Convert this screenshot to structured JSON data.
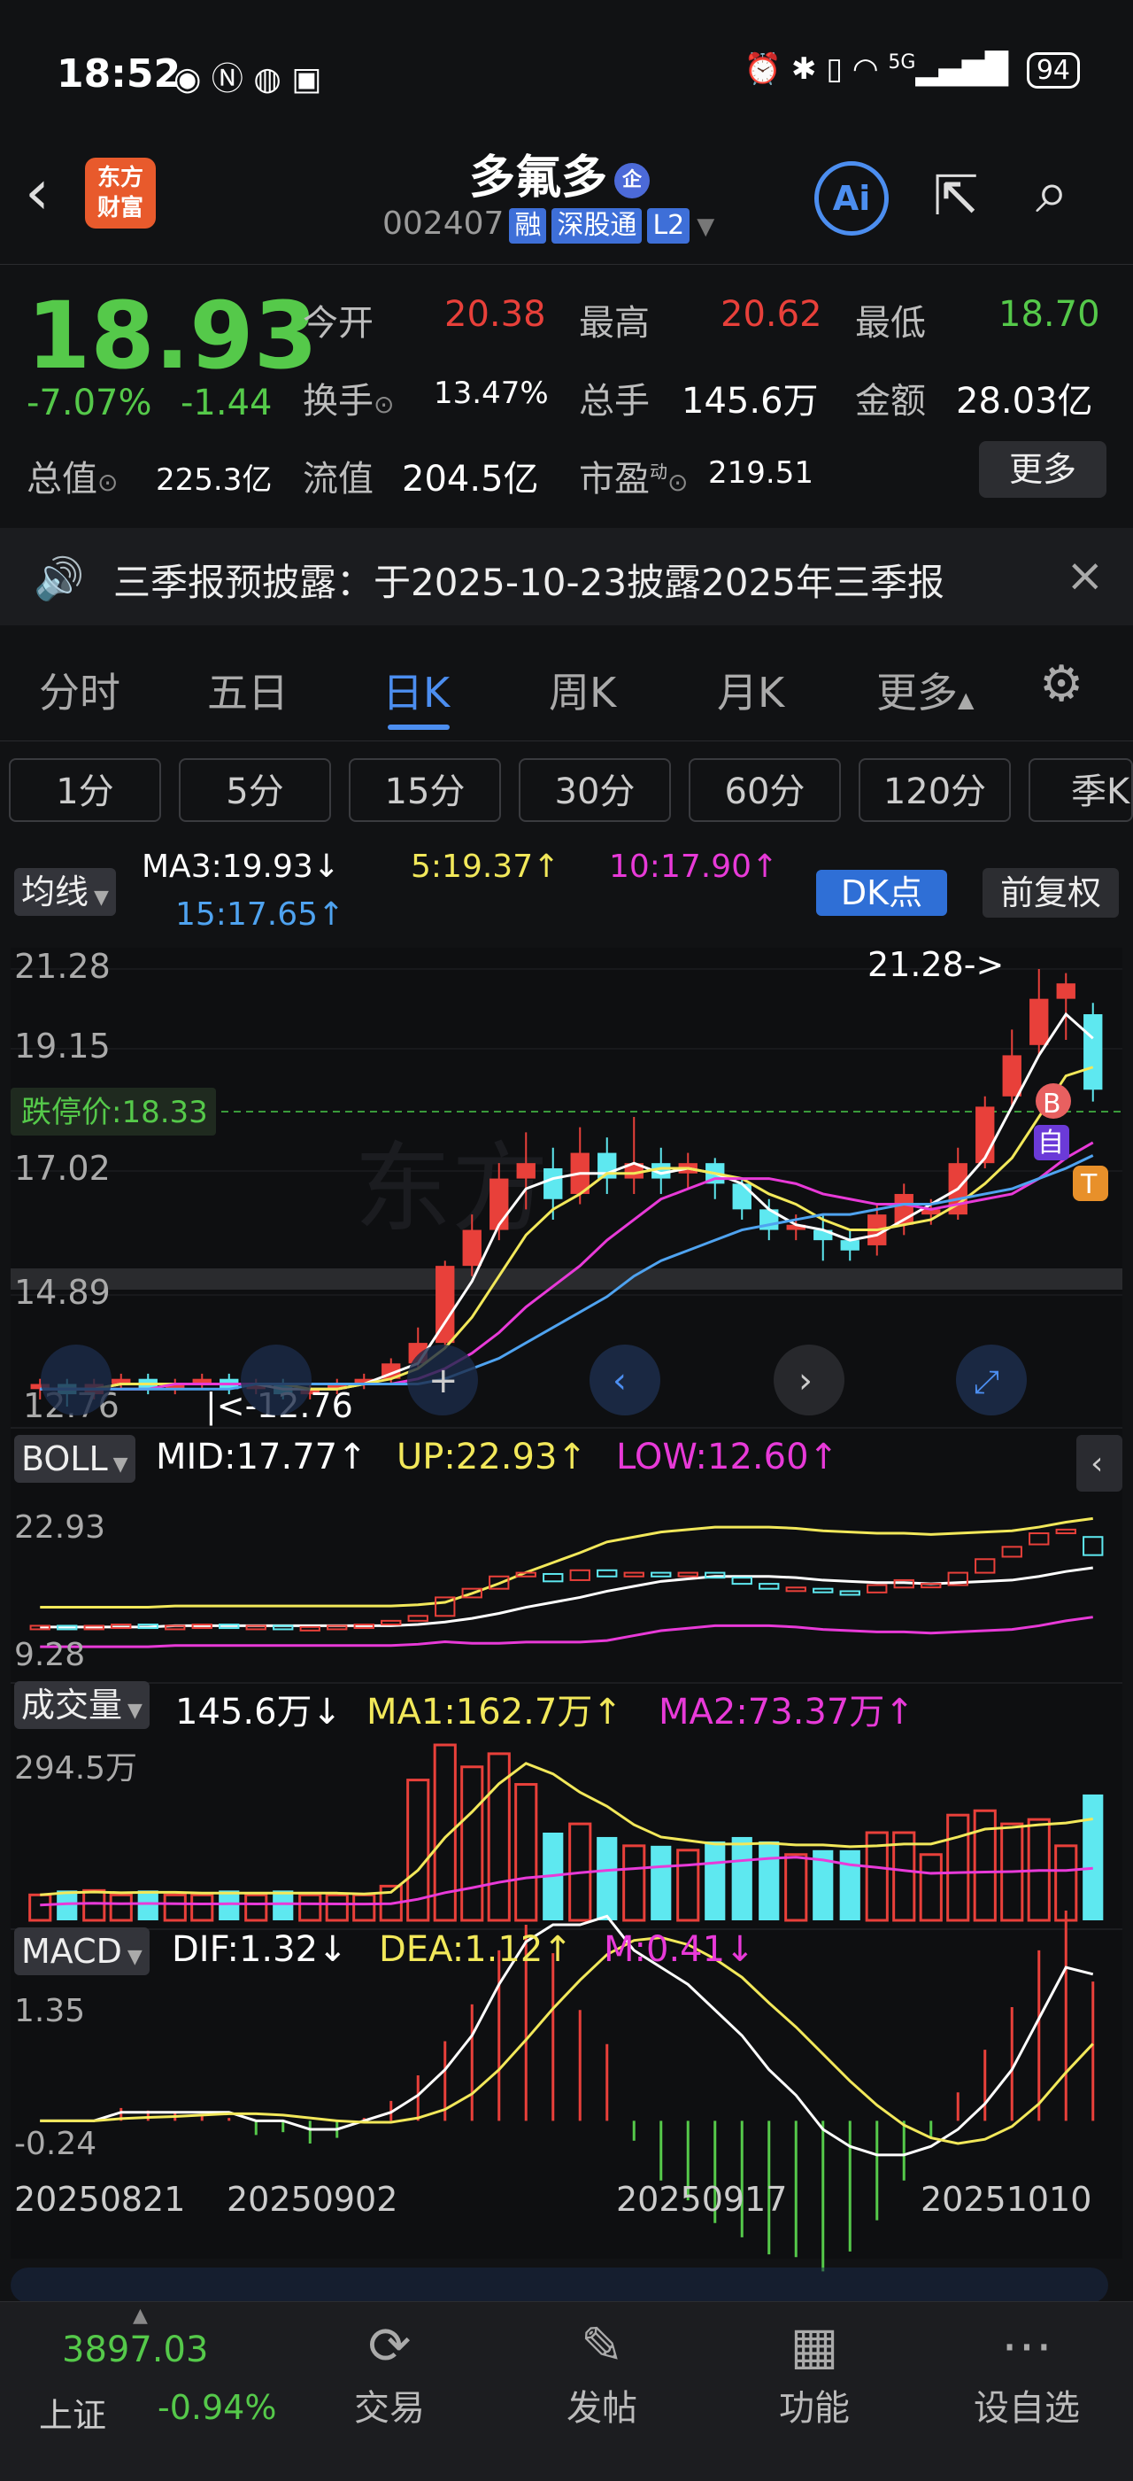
{
  "status_bar": {
    "time": "18:52",
    "network": "5G",
    "battery": "94"
  },
  "header": {
    "logo_line1": "东方",
    "logo_line2": "财富",
    "stock_name": "多氟多",
    "badge": "企",
    "code": "002407",
    "tags": [
      "融",
      "深股通",
      "L2"
    ],
    "ai_label": "Ai"
  },
  "quote": {
    "price": "18.93",
    "change_pct": "-7.07%",
    "change": "-1.44",
    "open_label": "今开",
    "open": "20.38",
    "high_label": "最高",
    "high": "20.62",
    "low_label": "最低",
    "low": "18.70",
    "turnover_label": "换手",
    "turnover": "13.47%",
    "volume_label": "总手",
    "volume": "145.6万",
    "amount_label": "金额",
    "amount": "28.03亿",
    "mcap_label": "总值",
    "mcap": "225.3亿",
    "float_label": "流值",
    "float": "204.5亿",
    "pe_label": "市盈",
    "pe_sup": "动",
    "pe": "219.51",
    "more": "更多"
  },
  "notice": {
    "text": "三季报预披露：于2025-10-23披露2025年三季报"
  },
  "tabs": [
    "分时",
    "五日",
    "日K",
    "周K",
    "月K",
    "更多"
  ],
  "active_tab": "日K",
  "periods": [
    "1分",
    "5分",
    "15分",
    "30分",
    "60分",
    "120分",
    "季K"
  ],
  "ma": {
    "selector": "均线",
    "ma3": "MA3:19.93",
    "ma5": "5:19.37",
    "ma10": "10:17.90",
    "ma15": "15:17.65",
    "dk": "DK点",
    "adjust": "前复权"
  },
  "kline": {
    "axis_labels": [
      "21.28",
      "19.15",
      "17.02",
      "14.89",
      "12.76"
    ],
    "limit_down_label": "跌停价:18.33",
    "max_label": "21.28->",
    "min_label": "12.76",
    "markers": [
      "B",
      "自",
      "T"
    ]
  },
  "boll": {
    "selector": "BOLL",
    "mid": "MID:17.77",
    "up": "UP:22.93",
    "low": "LOW:12.60",
    "axis_top": "22.93",
    "axis_bottom": "9.28"
  },
  "volume": {
    "selector": "成交量",
    "value": "145.6万",
    "ma1": "MA1:162.7万",
    "ma2": "MA2:73.37万",
    "axis_top": "294.5万"
  },
  "macd": {
    "selector": "MACD",
    "dif": "DIF:1.32",
    "dea": "DEA:1.12",
    "m": "M:0.41",
    "axis_top": "1.35",
    "axis_bottom": "-0.24"
  },
  "dates": [
    "20250821",
    "20250902",
    "20250917",
    "20251010"
  ],
  "bottom_bar": {
    "index_value": "3897.03",
    "index_name": "上证",
    "index_change": "-0.94%",
    "items": [
      "交易",
      "发帖",
      "功能",
      "设自选"
    ]
  },
  "chart_data": {
    "type": "candlestick",
    "candles": [
      {
        "o": 13.1,
        "c": 13.2,
        "h": 13.3,
        "l": 12.9
      },
      {
        "o": 13.2,
        "c": 13.0,
        "h": 13.3,
        "l": 12.76
      },
      {
        "o": 13.0,
        "c": 13.2,
        "h": 13.3,
        "l": 12.9
      },
      {
        "o": 13.2,
        "c": 13.3,
        "h": 13.4,
        "l": 13.1
      },
      {
        "o": 13.3,
        "c": 13.1,
        "h": 13.4,
        "l": 13.0
      },
      {
        "o": 13.1,
        "c": 13.2,
        "h": 13.3,
        "l": 13.0
      },
      {
        "o": 13.2,
        "c": 13.3,
        "h": 13.4,
        "l": 13.1
      },
      {
        "o": 13.3,
        "c": 13.1,
        "h": 13.4,
        "l": 13.0
      },
      {
        "o": 13.1,
        "c": 13.2,
        "h": 13.3,
        "l": 13.0
      },
      {
        "o": 13.2,
        "c": 13.0,
        "h": 13.3,
        "l": 12.9
      },
      {
        "o": 13.0,
        "c": 13.1,
        "h": 13.2,
        "l": 12.9
      },
      {
        "o": 13.1,
        "c": 13.2,
        "h": 13.3,
        "l": 13.0
      },
      {
        "o": 13.2,
        "c": 13.3,
        "h": 13.4,
        "l": 13.1
      },
      {
        "o": 13.3,
        "c": 13.6,
        "h": 13.7,
        "l": 13.2
      },
      {
        "o": 13.6,
        "c": 14.0,
        "h": 14.3,
        "l": 13.5
      },
      {
        "o": 14.0,
        "c": 15.5,
        "h": 15.6,
        "l": 13.9
      },
      {
        "o": 15.5,
        "c": 16.2,
        "h": 16.5,
        "l": 15.3
      },
      {
        "o": 16.2,
        "c": 17.2,
        "h": 17.5,
        "l": 16.0
      },
      {
        "o": 17.2,
        "c": 17.5,
        "h": 18.1,
        "l": 16.6
      },
      {
        "o": 17.4,
        "c": 16.8,
        "h": 17.8,
        "l": 16.4
      },
      {
        "o": 16.9,
        "c": 17.7,
        "h": 18.2,
        "l": 16.7
      },
      {
        "o": 17.7,
        "c": 17.2,
        "h": 18.0,
        "l": 16.9
      },
      {
        "o": 17.2,
        "c": 17.5,
        "h": 18.4,
        "l": 16.9
      },
      {
        "o": 17.5,
        "c": 17.2,
        "h": 17.8,
        "l": 16.9
      },
      {
        "o": 17.3,
        "c": 17.5,
        "h": 17.7,
        "l": 17.0
      },
      {
        "o": 17.5,
        "c": 17.1,
        "h": 17.6,
        "l": 16.8
      },
      {
        "o": 17.1,
        "c": 16.6,
        "h": 17.2,
        "l": 16.4
      },
      {
        "o": 16.6,
        "c": 16.2,
        "h": 16.8,
        "l": 16.0
      },
      {
        "o": 16.2,
        "c": 16.3,
        "h": 16.5,
        "l": 16.0
      },
      {
        "o": 16.2,
        "c": 16.0,
        "h": 16.5,
        "l": 15.6
      },
      {
        "o": 16.0,
        "c": 15.8,
        "h": 16.2,
        "l": 15.6
      },
      {
        "o": 15.9,
        "c": 16.5,
        "h": 16.7,
        "l": 15.7
      },
      {
        "o": 16.3,
        "c": 16.9,
        "h": 17.1,
        "l": 16.1
      },
      {
        "o": 16.5,
        "c": 16.6,
        "h": 16.8,
        "l": 16.3
      },
      {
        "o": 16.5,
        "c": 17.5,
        "h": 17.8,
        "l": 16.4
      },
      {
        "o": 17.5,
        "c": 18.6,
        "h": 18.8,
        "l": 17.4
      },
      {
        "o": 18.8,
        "c": 19.6,
        "h": 20.1,
        "l": 18.6
      },
      {
        "o": 19.8,
        "c": 20.7,
        "h": 21.28,
        "l": 19.6
      },
      {
        "o": 20.7,
        "c": 21.0,
        "h": 21.2,
        "l": 19.9
      },
      {
        "o": 20.4,
        "c": 18.93,
        "h": 20.62,
        "l": 18.7
      }
    ],
    "ylim": [
      12.76,
      21.28
    ],
    "series": [
      {
        "name": "MA3",
        "values": [
          13.1,
          13.1,
          13.1,
          13.2,
          13.2,
          13.2,
          13.2,
          13.2,
          13.2,
          13.1,
          13.1,
          13.1,
          13.2,
          13.4,
          13.6,
          14.4,
          15.2,
          16.3,
          17.0,
          17.2,
          17.3,
          17.3,
          17.5,
          17.3,
          17.4,
          17.3,
          17.1,
          16.6,
          16.3,
          16.2,
          16.0,
          16.1,
          16.4,
          16.7,
          17.0,
          17.6,
          18.6,
          19.6,
          20.4,
          19.93
        ]
      },
      {
        "name": "5",
        "values": [
          13.1,
          13.1,
          13.1,
          13.2,
          13.2,
          13.2,
          13.2,
          13.2,
          13.2,
          13.2,
          13.1,
          13.1,
          13.2,
          13.3,
          13.5,
          13.9,
          14.5,
          15.3,
          16.1,
          16.6,
          16.9,
          17.3,
          17.3,
          17.4,
          17.4,
          17.3,
          17.2,
          16.9,
          16.7,
          16.4,
          16.2,
          16.2,
          16.3,
          16.4,
          16.7,
          17.1,
          17.6,
          18.4,
          19.2,
          19.37
        ]
      },
      {
        "name": "10",
        "values": [
          13.1,
          13.1,
          13.1,
          13.1,
          13.1,
          13.2,
          13.2,
          13.2,
          13.2,
          13.2,
          13.2,
          13.2,
          13.2,
          13.2,
          13.3,
          13.5,
          13.8,
          14.2,
          14.7,
          15.1,
          15.5,
          16.0,
          16.4,
          16.8,
          17.0,
          17.2,
          17.2,
          17.2,
          17.1,
          16.9,
          16.8,
          16.7,
          16.7,
          16.6,
          16.7,
          16.8,
          16.9,
          17.2,
          17.6,
          17.9
        ]
      },
      {
        "name": "15",
        "values": [
          13.1,
          13.1,
          13.1,
          13.1,
          13.1,
          13.1,
          13.1,
          13.1,
          13.2,
          13.2,
          13.2,
          13.2,
          13.2,
          13.2,
          13.2,
          13.3,
          13.5,
          13.7,
          14.0,
          14.3,
          14.6,
          14.9,
          15.3,
          15.6,
          15.8,
          16.0,
          16.2,
          16.3,
          16.4,
          16.5,
          16.5,
          16.6,
          16.7,
          16.7,
          16.8,
          16.9,
          17.0,
          17.2,
          17.4,
          17.65
        ]
      }
    ]
  }
}
